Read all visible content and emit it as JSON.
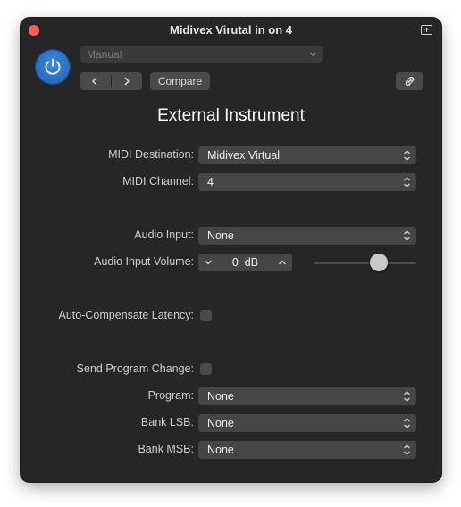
{
  "window": {
    "title": "Midivex Virutal in on 4"
  },
  "header": {
    "preset_value": "Manual",
    "compare_label": "Compare"
  },
  "plugin": {
    "heading": "External Instrument"
  },
  "fields": {
    "midi_destination": {
      "label": "MIDI Destination:",
      "value": "Midivex Virtual"
    },
    "midi_channel": {
      "label": "MIDI Channel:",
      "value": "4"
    },
    "audio_input": {
      "label": "Audio Input:",
      "value": "None"
    },
    "audio_input_volume": {
      "label": "Audio Input Volume:",
      "value": "0",
      "unit": "dB",
      "slider_fraction": 0.63
    },
    "auto_compensate_latency": {
      "label": "Auto-Compensate Latency:",
      "checked": false
    },
    "send_program_change": {
      "label": "Send Program Change:",
      "checked": false
    },
    "program": {
      "label": "Program:",
      "value": "None"
    },
    "bank_lsb": {
      "label": "Bank LSB:",
      "value": "None"
    },
    "bank_msb": {
      "label": "Bank MSB:",
      "value": "None"
    }
  },
  "colors": {
    "accent": "#2f78d0",
    "window_bg": "#262626",
    "close": "#ff5f57"
  }
}
